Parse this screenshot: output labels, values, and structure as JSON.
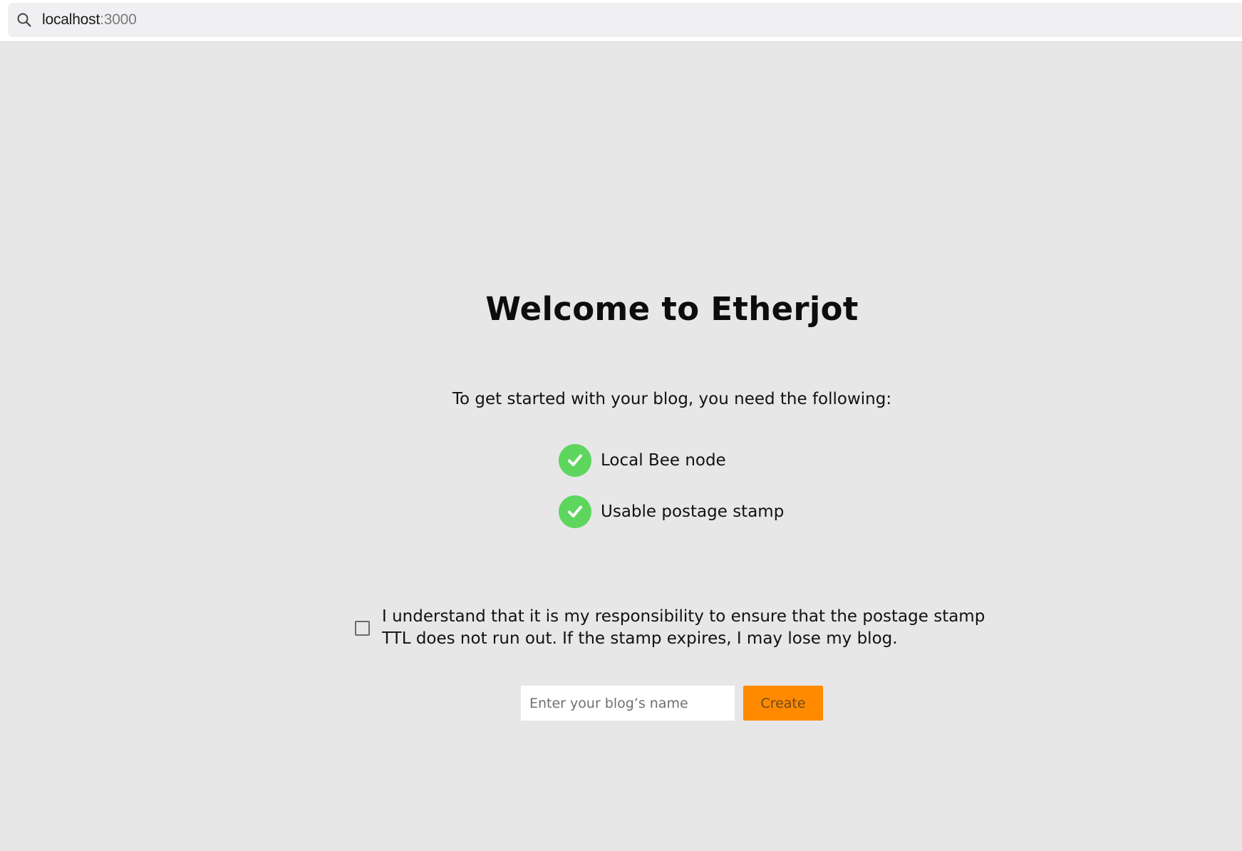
{
  "browser": {
    "url_host": "localhost",
    "url_port": ":3000",
    "search_icon": "search-icon"
  },
  "main": {
    "title": "Welcome to Etherjot",
    "subtitle": "To get started with your blog, you need the following:",
    "requirements": [
      {
        "label": "Local Bee node",
        "icon": "check-circle-icon",
        "status": "ok"
      },
      {
        "label": "Usable postage stamp",
        "icon": "check-circle-icon",
        "status": "ok"
      }
    ],
    "consent": {
      "text": "I understand that it is my responsibility to ensure that the postage stamp TTL does not run out. If the stamp expires, I may lose my blog.",
      "checked": false
    },
    "blog_name": {
      "value": "",
      "placeholder": "Enter your blog’s name"
    },
    "create_label": "Create"
  },
  "colors": {
    "page_background": "#e7e7e7",
    "check_green": "#5ed65e",
    "create_orange": "#ff8a00"
  }
}
